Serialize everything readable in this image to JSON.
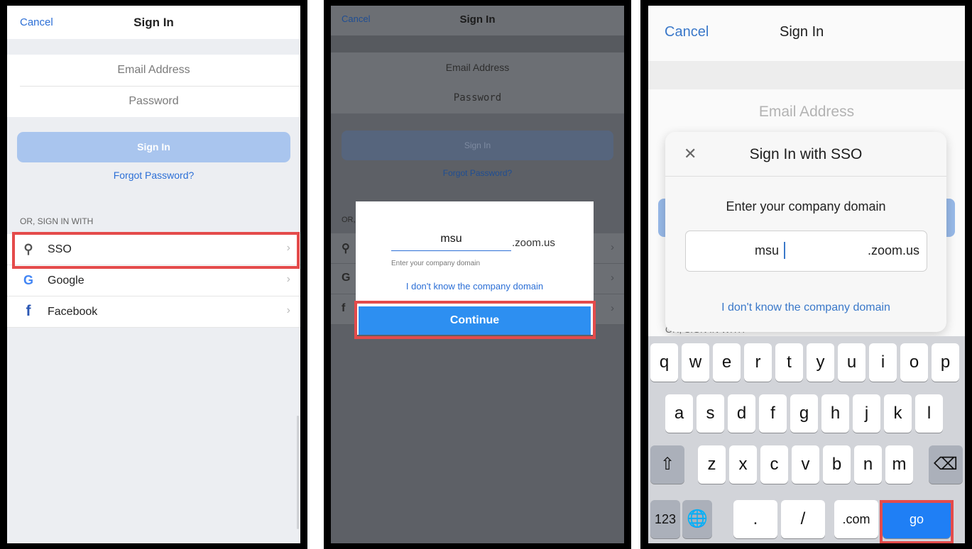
{
  "panel1": {
    "nav": {
      "cancel": "Cancel",
      "title": "Sign In"
    },
    "fields": {
      "email_placeholder": "Email Address",
      "password_placeholder": "Password"
    },
    "sign_in_label": "Sign In",
    "forgot_password": "Forgot Password?",
    "or_label": "OR, SIGN IN WITH",
    "providers": [
      {
        "label": "SSO",
        "icon": "key-icon",
        "glyph": "⚲",
        "color": "#555555"
      },
      {
        "label": "Google",
        "icon": "google-icon",
        "glyph": "G",
        "color": "#4285f4"
      },
      {
        "label": "Facebook",
        "icon": "facebook-icon",
        "glyph": "f",
        "color": "#2a56b3"
      }
    ],
    "highlighted": "SSO"
  },
  "panel2": {
    "nav": {
      "cancel": "Cancel",
      "title": "Sign In"
    },
    "fields": {
      "email_placeholder": "Email Address",
      "password_placeholder": "Password"
    },
    "sign_in_label": "Sign In",
    "forgot_password": "Forgot Password?",
    "or_label": "OR,",
    "provider_glyphs": [
      "⚲",
      "G",
      "f"
    ],
    "modal": {
      "domain_value": "msu",
      "domain_suffix": ".zoom.us",
      "hint": "Enter your company domain",
      "unknown_domain_link": "I don't know the company domain",
      "continue_label": "Continue"
    },
    "highlighted": "Continue"
  },
  "panel3": {
    "nav": {
      "cancel": "Cancel",
      "title": "Sign In"
    },
    "email_placeholder": "Email Address",
    "behind_text": "OR, SIGN IN WITH",
    "modal": {
      "close_glyph": "✕",
      "title": "Sign In with SSO",
      "prompt": "Enter your company domain",
      "domain_value": "msu",
      "domain_suffix": ".zoom.us",
      "unknown_domain_link": "I don't know the company domain"
    },
    "keyboard": {
      "row1": [
        "q",
        "w",
        "e",
        "r",
        "t",
        "y",
        "u",
        "i",
        "o",
        "p"
      ],
      "row2": [
        "a",
        "s",
        "d",
        "f",
        "g",
        "h",
        "j",
        "k",
        "l"
      ],
      "row3": [
        "z",
        "x",
        "c",
        "v",
        "b",
        "n",
        "m"
      ],
      "shift_glyph": "⇧",
      "delete_glyph": "⌫",
      "numbers_label": "123",
      "globe_glyph": "🌐",
      "dot_label": ".",
      "slash_label": "/",
      "com_label": ".com",
      "go_label": "go"
    },
    "highlighted": "go",
    "colors": {
      "go_key": "#1f7ff5",
      "highlight": "#e44b4b"
    }
  }
}
